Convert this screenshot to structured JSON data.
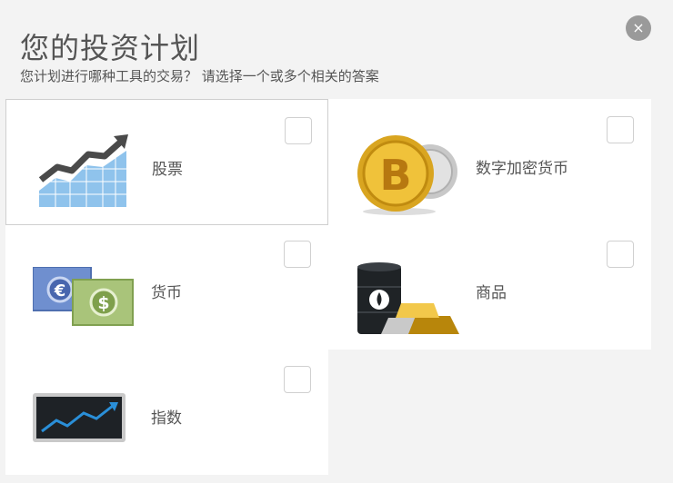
{
  "dialog": {
    "title": "您的投资计划",
    "subtitle": "您计划进行哪种工具的交易？ 请选择一个或多个相关的答案",
    "close_icon": "×"
  },
  "options": [
    {
      "label": "股票",
      "icon": "stock-chart-icon"
    },
    {
      "label": "数字加密货币",
      "icon": "bitcoin-icon"
    },
    {
      "label": "货币",
      "icon": "currency-banknotes-icon"
    },
    {
      "label": "商品",
      "icon": "oil-and-gold-icon"
    },
    {
      "label": "指数",
      "icon": "index-chart-icon"
    }
  ],
  "colors": {
    "background": "#f3f3f3",
    "card": "#ffffff",
    "close_button": "#9a9a9a"
  }
}
